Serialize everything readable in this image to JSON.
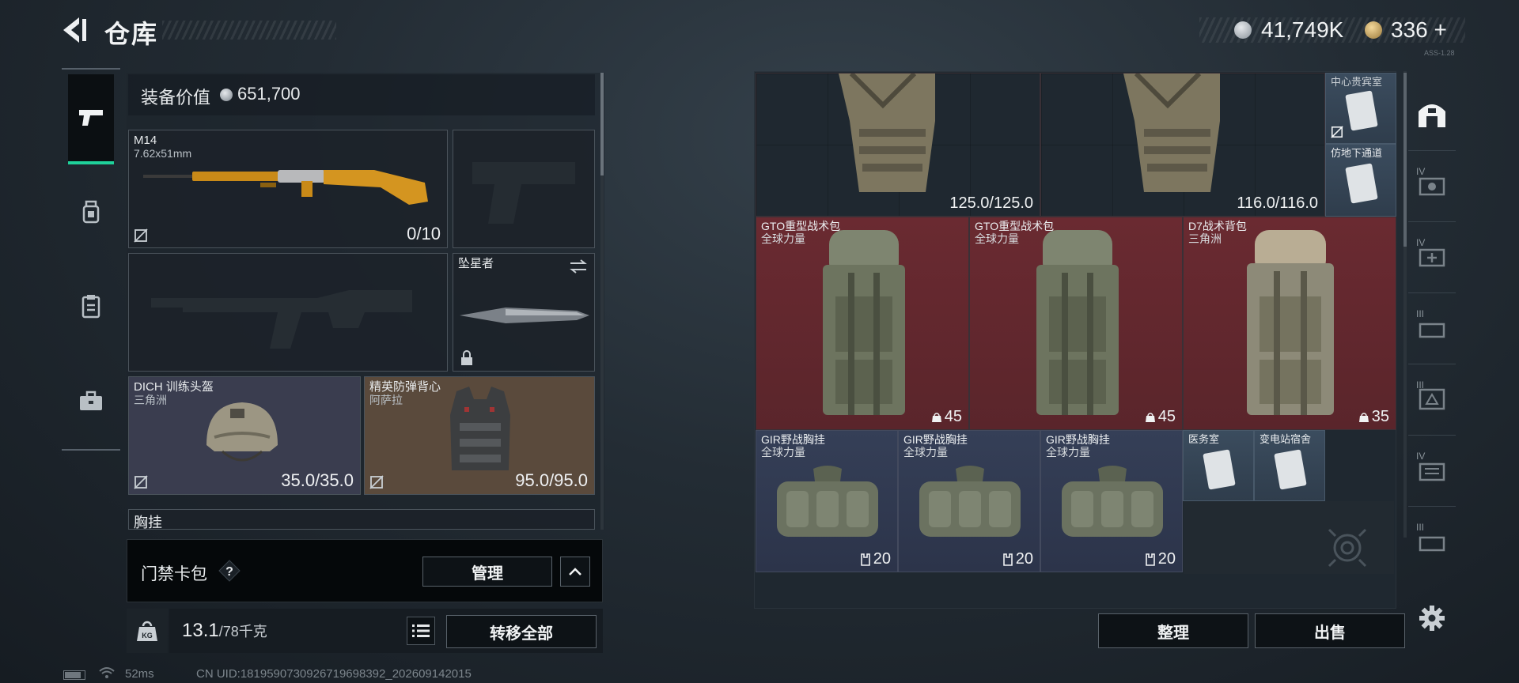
{
  "header": {
    "title": "仓库",
    "currency_1": "41,749K",
    "currency_2": "336",
    "currency_2_add": "+",
    "version_text": "ASS-1.28"
  },
  "left_nav": {
    "items": [
      "pistol-icon",
      "helmet-rig-icon",
      "clipboard-icon",
      "briefcase-icon"
    ]
  },
  "equipment": {
    "value_label": "装备价值",
    "value": "651,700",
    "slots": {
      "primary": {
        "name": "M14",
        "sub": "7.62x51mm",
        "ammo": "0/10"
      },
      "knife": {
        "name": "坠星者"
      },
      "helmet": {
        "name": "DICH 训练头盔",
        "sub": "三角洲",
        "durability": "35.0/35.0"
      },
      "armor": {
        "name": "精英防弹背心",
        "sub": "阿萨拉",
        "durability": "95.0/95.0"
      },
      "chest_rig_partial": "胸挂"
    }
  },
  "card_bar": {
    "label": "门禁卡包",
    "help": "?",
    "manage": "管理"
  },
  "weight": {
    "current": "13.1",
    "max": "/78千克",
    "icon_text": "KG"
  },
  "transfer_all": "转移全部",
  "status": {
    "ping": "52ms",
    "uid": "CN UID:1819590730926719698392_202609142015"
  },
  "stash": {
    "row1": [
      {
        "durability": "125.0/125.0"
      },
      {
        "durability": "116.0/116.0"
      }
    ],
    "cards_top": [
      {
        "name": "中心贵宾室"
      },
      {
        "name": "仿地下通道"
      }
    ],
    "backpacks": [
      {
        "name": "GTO重型战术包",
        "sub": "全球力量",
        "capacity": "45"
      },
      {
        "name": "GTO重型战术包",
        "sub": "全球力量",
        "capacity": "45"
      },
      {
        "name": "D7战术背包",
        "sub": "三角洲",
        "capacity": "35"
      }
    ],
    "rigs": [
      {
        "name": "GIR野战胸挂",
        "sub": "全球力量",
        "capacity": "20"
      },
      {
        "name": "GIR野战胸挂",
        "sub": "全球力量",
        "capacity": "20"
      },
      {
        "name": "GIR野战胸挂",
        "sub": "全球力量",
        "capacity": "20"
      }
    ],
    "cards_bottom": [
      {
        "name": "医务室"
      },
      {
        "name": "变电站宿舍"
      }
    ]
  },
  "actions": {
    "tidy": "整理",
    "sell": "出售"
  },
  "right_tabs": [
    "base-icon",
    "IV",
    "IV",
    "III",
    "III",
    "IV",
    "III"
  ],
  "colors": {
    "accent_green": "#1fd19a",
    "slot_red": "#6a2a31",
    "slot_blue": "#353f57"
  }
}
